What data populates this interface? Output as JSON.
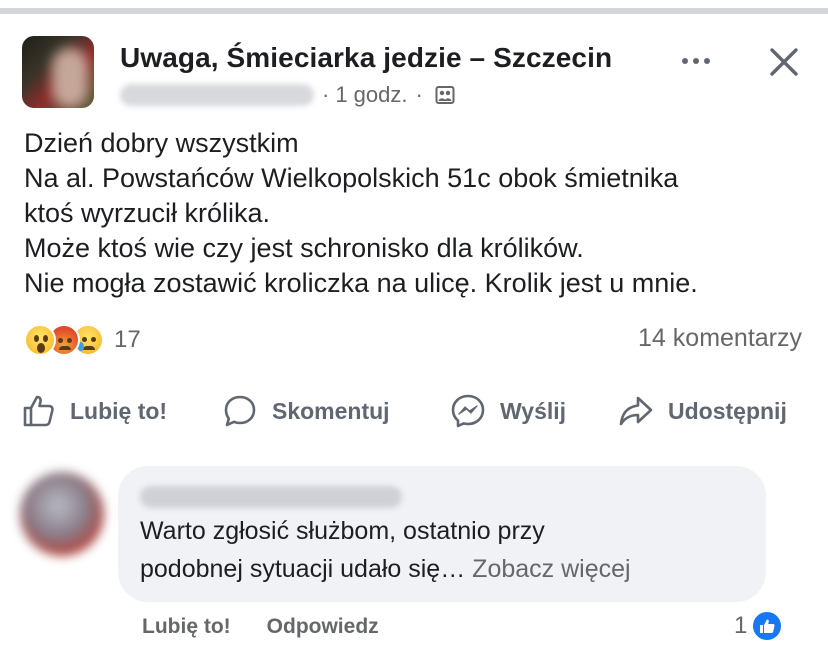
{
  "post": {
    "group_name": "Uwaga, Śmieciarka jedzie – Szczecin",
    "time": "1 godz.",
    "separator": "·",
    "text_lines": [
      "Dzień dobry wszystkim",
      "Na al. Powstańców Wielkopolskich 51c obok śmietnika",
      "ktoś wyrzucił królika.",
      "Może ktoś wie czy jest schronisko dla królików.",
      "Nie mogła zostawić kroliczka na ulicę. Krolik jest u mnie."
    ],
    "reactions": {
      "icons": [
        "wow-reaction-icon",
        "angry-reaction-icon",
        "sad-reaction-icon"
      ],
      "count": "17"
    },
    "comments_count": "14 komentarzy"
  },
  "actions": {
    "like": "Lubię to!",
    "comment": "Skomentuj",
    "send": "Wyślij",
    "share": "Udostępnij"
  },
  "comment": {
    "text_lines": [
      "Warto zgłosić służbom, ostatnio przy",
      "podobnej sytuacji udało się…"
    ],
    "see_more": "Zobacz więcej",
    "like_label": "Lubię to!",
    "reply_label": "Odpowiedz",
    "like_count": "1"
  },
  "colors": {
    "accent": "#1877f2",
    "secondary_text": "#65676b",
    "bubble": "#f0f2f5"
  }
}
